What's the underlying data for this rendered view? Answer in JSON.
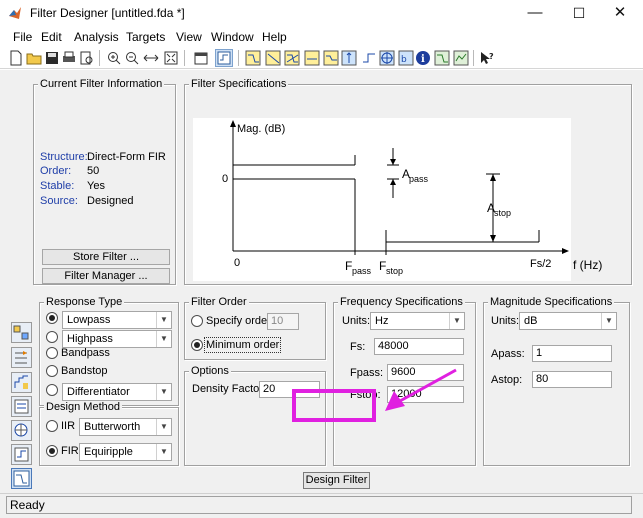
{
  "window": {
    "title": "Filter Designer   [untitled.fda *]",
    "controls": {
      "minimize": "—",
      "maximize": "☐",
      "close": "✕"
    }
  },
  "menu": [
    "File",
    "Edit",
    "Analysis",
    "Targets",
    "View",
    "Window",
    "Help"
  ],
  "current_filter": {
    "title": "Current Filter Information",
    "rows": [
      {
        "label": "Structure:",
        "value": "Direct-Form FIR"
      },
      {
        "label": "Order:",
        "value": "50"
      },
      {
        "label": "Stable:",
        "value": "Yes"
      },
      {
        "label": "Source:",
        "value": "Designed"
      }
    ],
    "store_button": "Store Filter ...",
    "manager_button": "Filter Manager ..."
  },
  "filter_specs": {
    "title": "Filter Specifications",
    "ylabel": "Mag. (dB)",
    "zero": "0",
    "x_zero": "0",
    "fpass": "F",
    "fpass_sub": "pass",
    "fstop": "F",
    "fstop_sub": "stop",
    "fs2": "Fs/2",
    "xlabel": "f (Hz)",
    "apass": "A",
    "apass_sub": "pass",
    "astop": "A",
    "astop_sub": "stop"
  },
  "response_type": {
    "title": "Response Type",
    "lowpass": "Lowpass",
    "highpass": "Highpass",
    "bandpass": "Bandpass",
    "bandstop": "Bandstop",
    "differentiator": "Differentiator"
  },
  "design_method": {
    "title": "Design Method",
    "iir_label": "IIR",
    "iir_value": "Butterworth",
    "fir_label": "FIR",
    "fir_value": "Equiripple"
  },
  "filter_order": {
    "title": "Filter Order",
    "specify_label": "Specify order:",
    "specify_value": "10",
    "minimum_label": "Minimum order"
  },
  "options": {
    "title": "Options",
    "density_label": "Density Factor:",
    "density_value": "20"
  },
  "freq_specs": {
    "title": "Frequency Specifications",
    "units_label": "Units:",
    "units_value": "Hz",
    "fs_label": "Fs:",
    "fs_value": "48000",
    "fpass_label": "Fpass:",
    "fpass_value": "9600",
    "fstop_label": "Fstop:",
    "fstop_value": "12000"
  },
  "mag_specs": {
    "title": "Magnitude Specifications",
    "units_label": "Units:",
    "units_value": "dB",
    "apass_label": "Apass:",
    "apass_value": "1",
    "astop_label": "Astop:",
    "astop_value": "80"
  },
  "design_button": "Design Filter",
  "status": "Ready",
  "colors": {
    "highlight": "#e020e0",
    "info_blue": "#1f3ea8",
    "panel": "#f0f0f0"
  }
}
